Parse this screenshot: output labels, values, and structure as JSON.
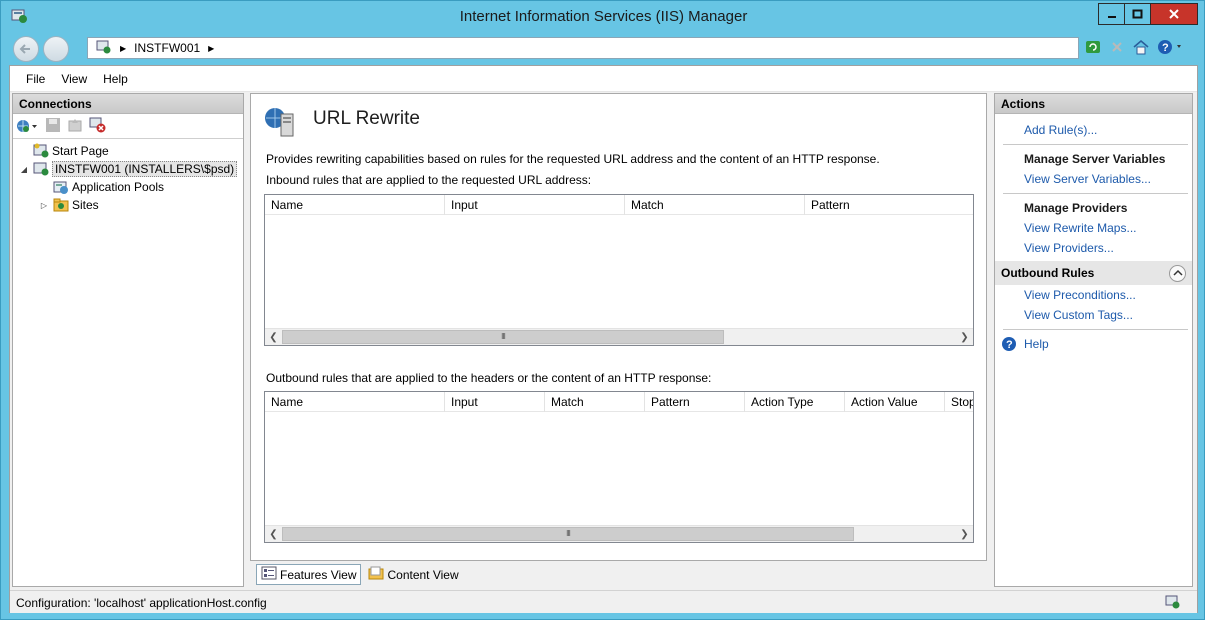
{
  "window": {
    "title": "Internet Information Services (IIS) Manager",
    "controls": [
      "minimize",
      "maximize",
      "close"
    ]
  },
  "address_bar": {
    "segments": [
      "INSTFW001"
    ]
  },
  "menu": [
    "File",
    "View",
    "Help"
  ],
  "connections": {
    "header": "Connections",
    "tree": [
      {
        "label": "Start Page",
        "icon": "start-page-icon",
        "level": 0
      },
      {
        "label": "INSTFW001 (INSTALLERS\\$psd)",
        "icon": "server-icon",
        "level": 0,
        "expanded": true,
        "selected": true
      },
      {
        "label": "Application Pools",
        "icon": "app-pools-icon",
        "level": 1
      },
      {
        "label": "Sites",
        "icon": "sites-icon",
        "level": 1,
        "expanded": false
      }
    ]
  },
  "feature": {
    "title": "URL Rewrite",
    "description": "Provides rewriting capabilities based on rules for the requested URL address and the content of an HTTP response.",
    "inbound_label": "Inbound rules that are applied to the requested URL address:",
    "inbound_columns": [
      "Name",
      "Input",
      "Match",
      "Pattern"
    ],
    "outbound_label": "Outbound rules that are applied to the headers or the content of an HTTP response:",
    "outbound_columns": [
      "Name",
      "Input",
      "Match",
      "Pattern",
      "Action Type",
      "Action Value",
      "Stop"
    ],
    "scroll_thumb": "III"
  },
  "view_tabs": {
    "features": "Features View",
    "content": "Content View",
    "active": "features"
  },
  "actions": {
    "header": "Actions",
    "add_rules": "Add Rule(s)...",
    "server_variables_header": "Manage Server Variables",
    "view_server_variables": "View Server Variables...",
    "providers_header": "Manage Providers",
    "view_rewrite_maps": "View Rewrite Maps...",
    "view_providers": "View Providers...",
    "outbound_section": "Outbound Rules",
    "view_preconditions": "View Preconditions...",
    "view_custom_tags": "View Custom Tags...",
    "help": "Help"
  },
  "status": {
    "text": "Configuration: 'localhost' applicationHost.config"
  },
  "colors": {
    "window_frame": "#67c5e4",
    "close_button": "#c7342a",
    "link": "#1d5aab"
  }
}
